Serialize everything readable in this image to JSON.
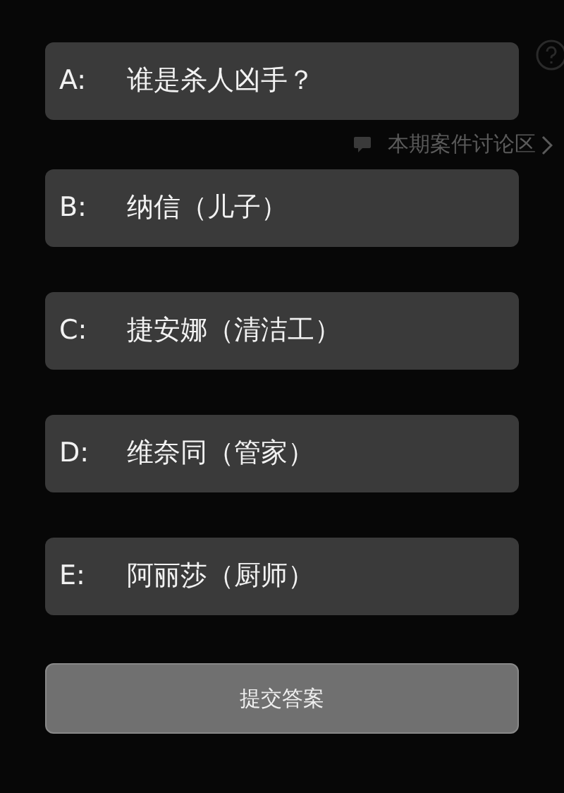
{
  "options": [
    {
      "label": "A:",
      "text": "谁是杀人凶手？"
    },
    {
      "label": "B:",
      "text": "纳信（儿子）"
    },
    {
      "label": "C:",
      "text": "捷安娜（清洁工）"
    },
    {
      "label": "D:",
      "text": "维奈同（管家）"
    },
    {
      "label": "E:",
      "text": "阿丽莎（厨师）"
    }
  ],
  "discussion_link": {
    "text": "本期案件讨论区"
  },
  "submit_button": {
    "label": "提交答案"
  }
}
